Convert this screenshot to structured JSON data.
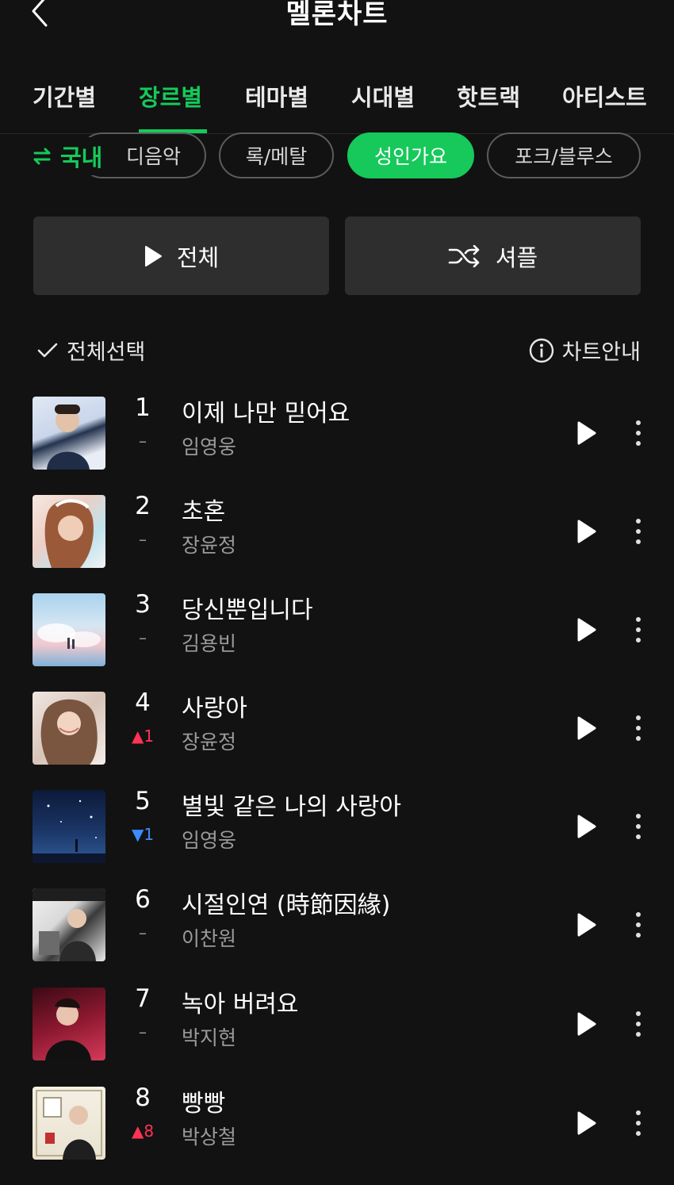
{
  "header": {
    "title": "멜론차트"
  },
  "tabs": [
    "기간별",
    "장르별",
    "테마별",
    "시대별",
    "핫트랙",
    "아티스트"
  ],
  "genre": {
    "region": "국내",
    "chips": [
      {
        "label": "디음악",
        "active": false
      },
      {
        "label": "록/메탈",
        "active": false
      },
      {
        "label": "성인가요",
        "active": true
      },
      {
        "label": "포크/블루스",
        "active": false
      }
    ]
  },
  "buttons": {
    "play_all": "전체",
    "shuffle": "셔플"
  },
  "toolbar": {
    "select_all": "전체선택",
    "chart_guide": "차트안내"
  },
  "colors": {
    "accent": "#16c95a",
    "up": "#ff3355",
    "down": "#3d8bff",
    "background": "#121212"
  },
  "songs": [
    {
      "rank": "1",
      "change": "–",
      "change_dir": "same",
      "title": "이제 나만 믿어요",
      "artist": "임영웅"
    },
    {
      "rank": "2",
      "change": "–",
      "change_dir": "same",
      "title": "초혼",
      "artist": "장윤정"
    },
    {
      "rank": "3",
      "change": "–",
      "change_dir": "same",
      "title": "당신뿐입니다",
      "artist": "김용빈"
    },
    {
      "rank": "4",
      "change": "▲1",
      "change_dir": "up",
      "title": "사랑아",
      "artist": "장윤정"
    },
    {
      "rank": "5",
      "change": "▼1",
      "change_dir": "down",
      "title": "별빛 같은 나의 사랑아",
      "artist": "임영웅"
    },
    {
      "rank": "6",
      "change": "–",
      "change_dir": "same",
      "title": "시절인연 (時節因緣)",
      "artist": "이찬원"
    },
    {
      "rank": "7",
      "change": "–",
      "change_dir": "same",
      "title": "녹아 버려요",
      "artist": "박지현"
    },
    {
      "rank": "8",
      "change": "▲8",
      "change_dir": "up",
      "title": "빵빵",
      "artist": "박상철"
    }
  ]
}
